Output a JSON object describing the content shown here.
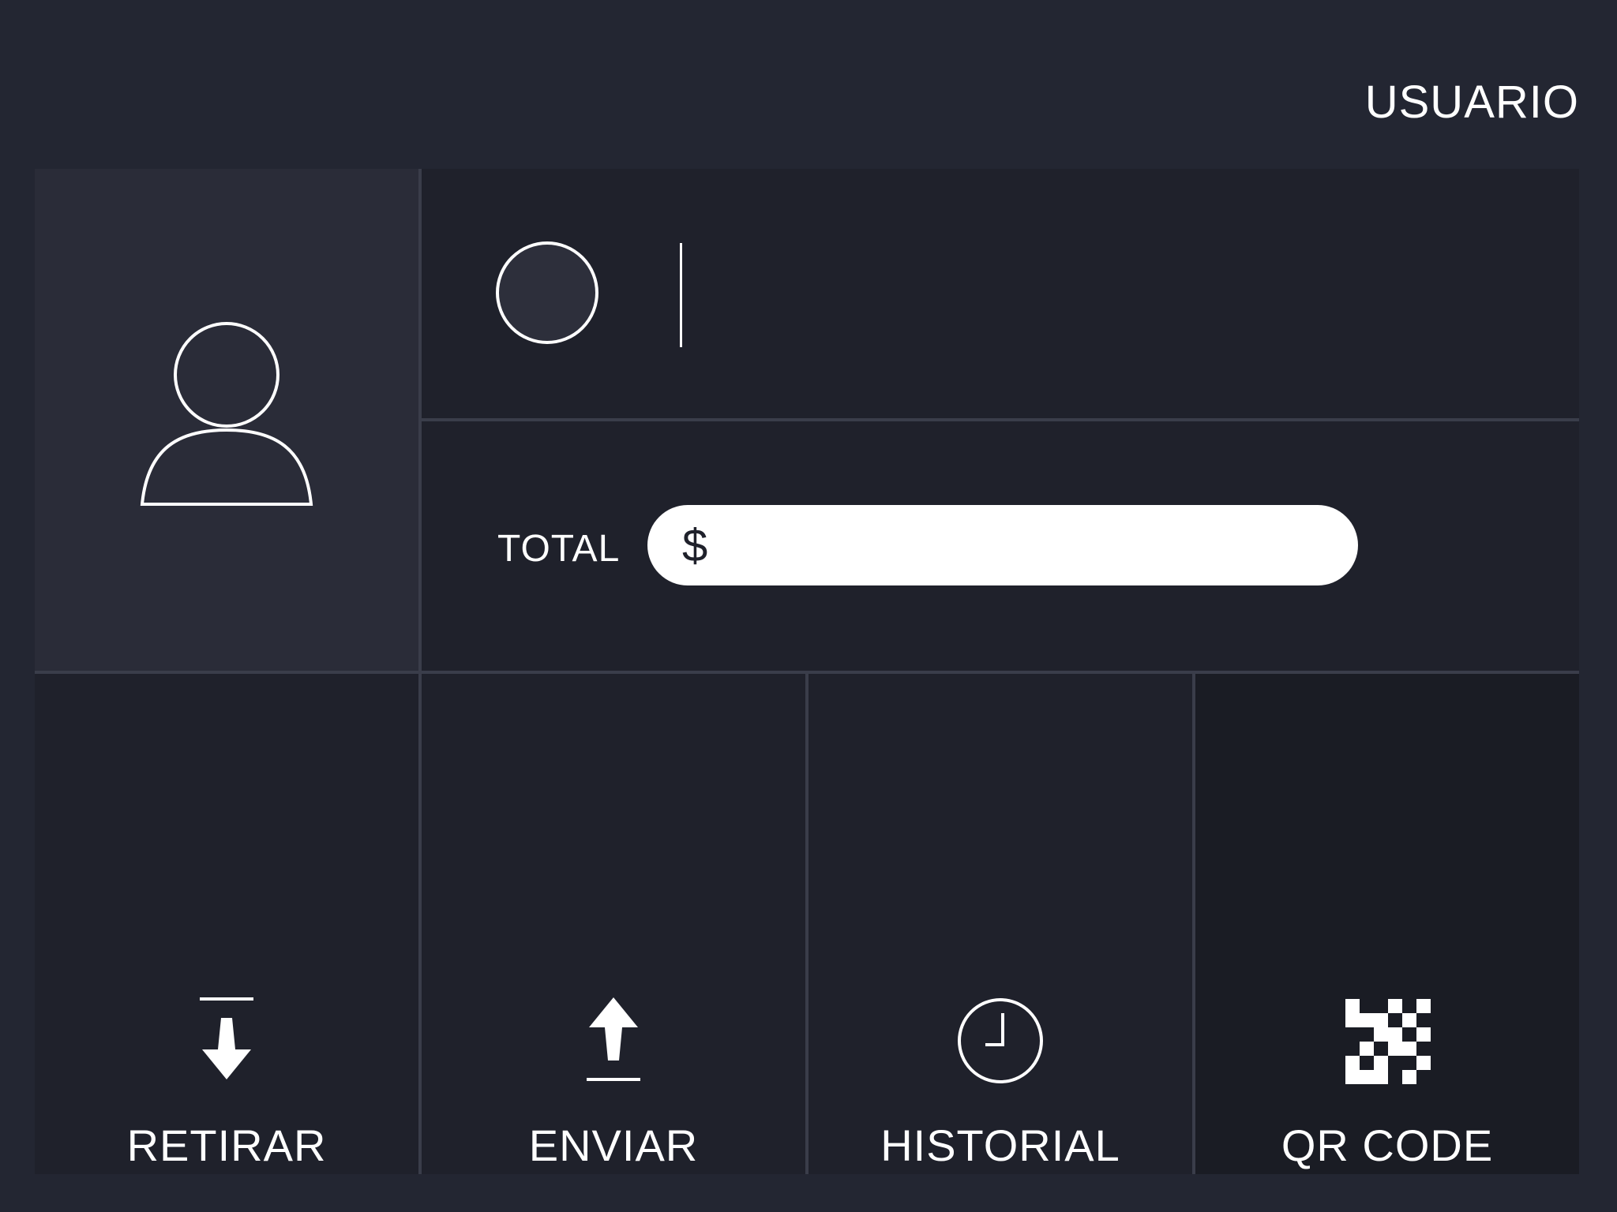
{
  "header": {
    "user_label": "USUARIO"
  },
  "profile": {
    "avatar_icon": "user-icon"
  },
  "account": {
    "status_icon": "circle-indicator-icon"
  },
  "balance": {
    "label": "TOTAL",
    "currency_symbol": "$",
    "value": ""
  },
  "actions": [
    {
      "label": "RETIRAR",
      "icon": "download-arrow-icon"
    },
    {
      "label": "ENVIAR",
      "icon": "upload-arrow-icon"
    },
    {
      "label": "HISTORIAL",
      "icon": "clock-icon"
    },
    {
      "label": "QR CODE",
      "icon": "qr-code-icon"
    }
  ],
  "colors": {
    "background": "#232632",
    "tile": "#1f212b",
    "profile_tile": "#2a2c38",
    "qr_tile": "#1a1c24",
    "divider": "#3a3d4a",
    "foreground": "#ffffff"
  }
}
